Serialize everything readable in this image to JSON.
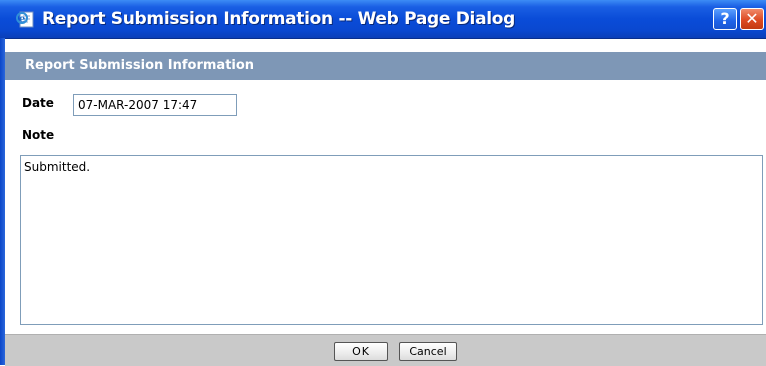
{
  "window": {
    "title": "Report Submission Information -- Web Page Dialog",
    "help_label": "?",
    "close_label": "✕"
  },
  "section": {
    "title": "Report Submission Information"
  },
  "form": {
    "date_label": "Date",
    "date_value": "07-MAR-2007 17:47",
    "note_label": "Note",
    "note_value": "Submitted."
  },
  "buttons": {
    "ok_label": "OK",
    "cancel_label": "Cancel"
  },
  "icons": {
    "title_icon": "ie-page-icon",
    "help_icon": "help-icon",
    "close_icon": "close-icon"
  },
  "colors": {
    "titlebar": "#0a4cd8",
    "section_header": "#7e97b6",
    "footer": "#c9c9c9",
    "close_button": "#dd4a22"
  }
}
